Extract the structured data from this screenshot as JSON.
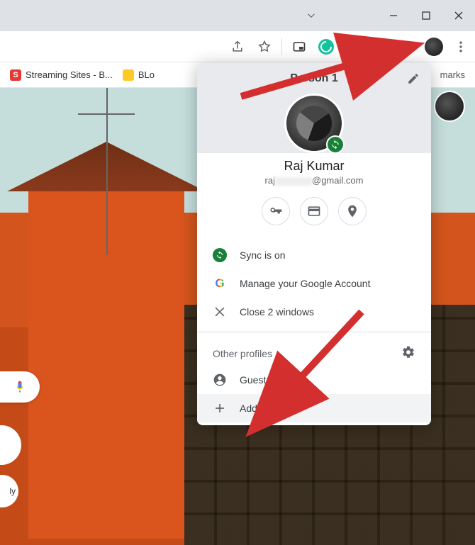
{
  "bookmarks": {
    "item1": "Streaming Sites - B...",
    "item2": "BLo",
    "right": "marks"
  },
  "profile": {
    "title": "Person 1",
    "name": "Raj Kumar",
    "email_prefix": "raj",
    "email_suffix": "@gmail.com"
  },
  "menu": {
    "sync": "Sync is on",
    "manage": "Manage your Google Account",
    "close": "Close 2 windows",
    "other_header": "Other profiles",
    "guest": "Guest",
    "add": "Add"
  },
  "misc": {
    "ly": "ly"
  }
}
